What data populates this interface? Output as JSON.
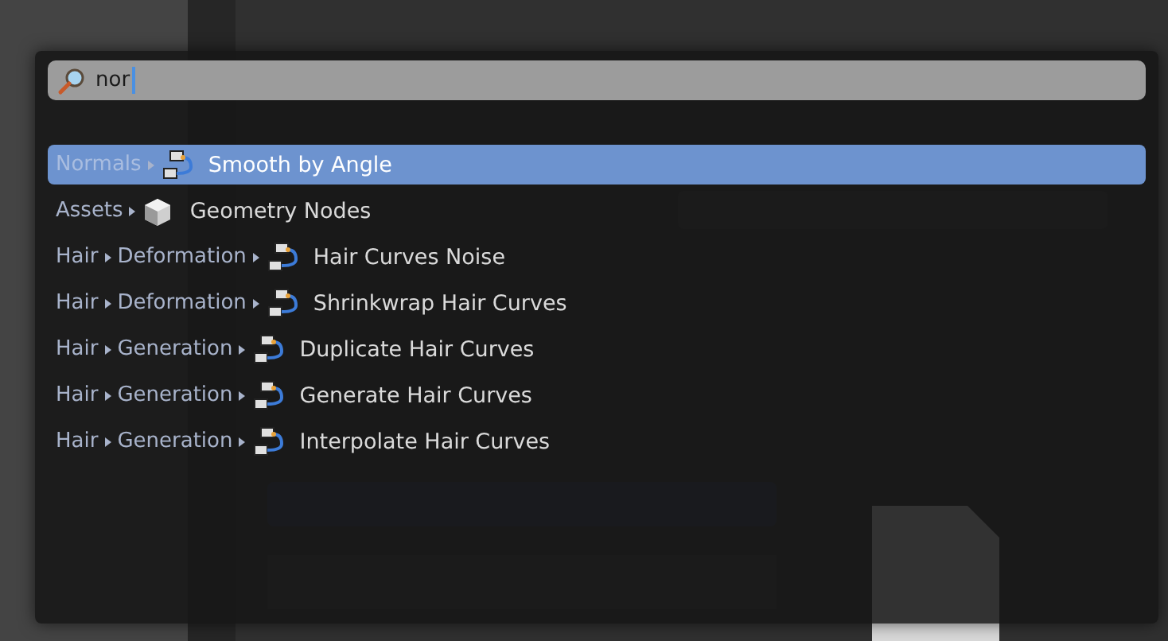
{
  "search": {
    "value": "nor"
  },
  "results": [
    {
      "path": [
        "Normals"
      ],
      "kind": "node_group",
      "name": "Smooth by Angle",
      "selected": true
    },
    {
      "path": [
        "Assets"
      ],
      "kind": "asset",
      "name": "Geometry Nodes",
      "selected": false
    },
    {
      "path": [
        "Hair",
        "Deformation"
      ],
      "kind": "node_group",
      "name": "Hair Curves Noise",
      "selected": false
    },
    {
      "path": [
        "Hair",
        "Deformation"
      ],
      "kind": "node_group",
      "name": "Shrinkwrap Hair Curves",
      "selected": false
    },
    {
      "path": [
        "Hair",
        "Generation"
      ],
      "kind": "node_group",
      "name": "Duplicate Hair Curves",
      "selected": false
    },
    {
      "path": [
        "Hair",
        "Generation"
      ],
      "kind": "node_group",
      "name": "Generate Hair Curves",
      "selected": false
    },
    {
      "path": [
        "Hair",
        "Generation"
      ],
      "kind": "node_group",
      "name": "Interpolate Hair Curves",
      "selected": false
    }
  ]
}
